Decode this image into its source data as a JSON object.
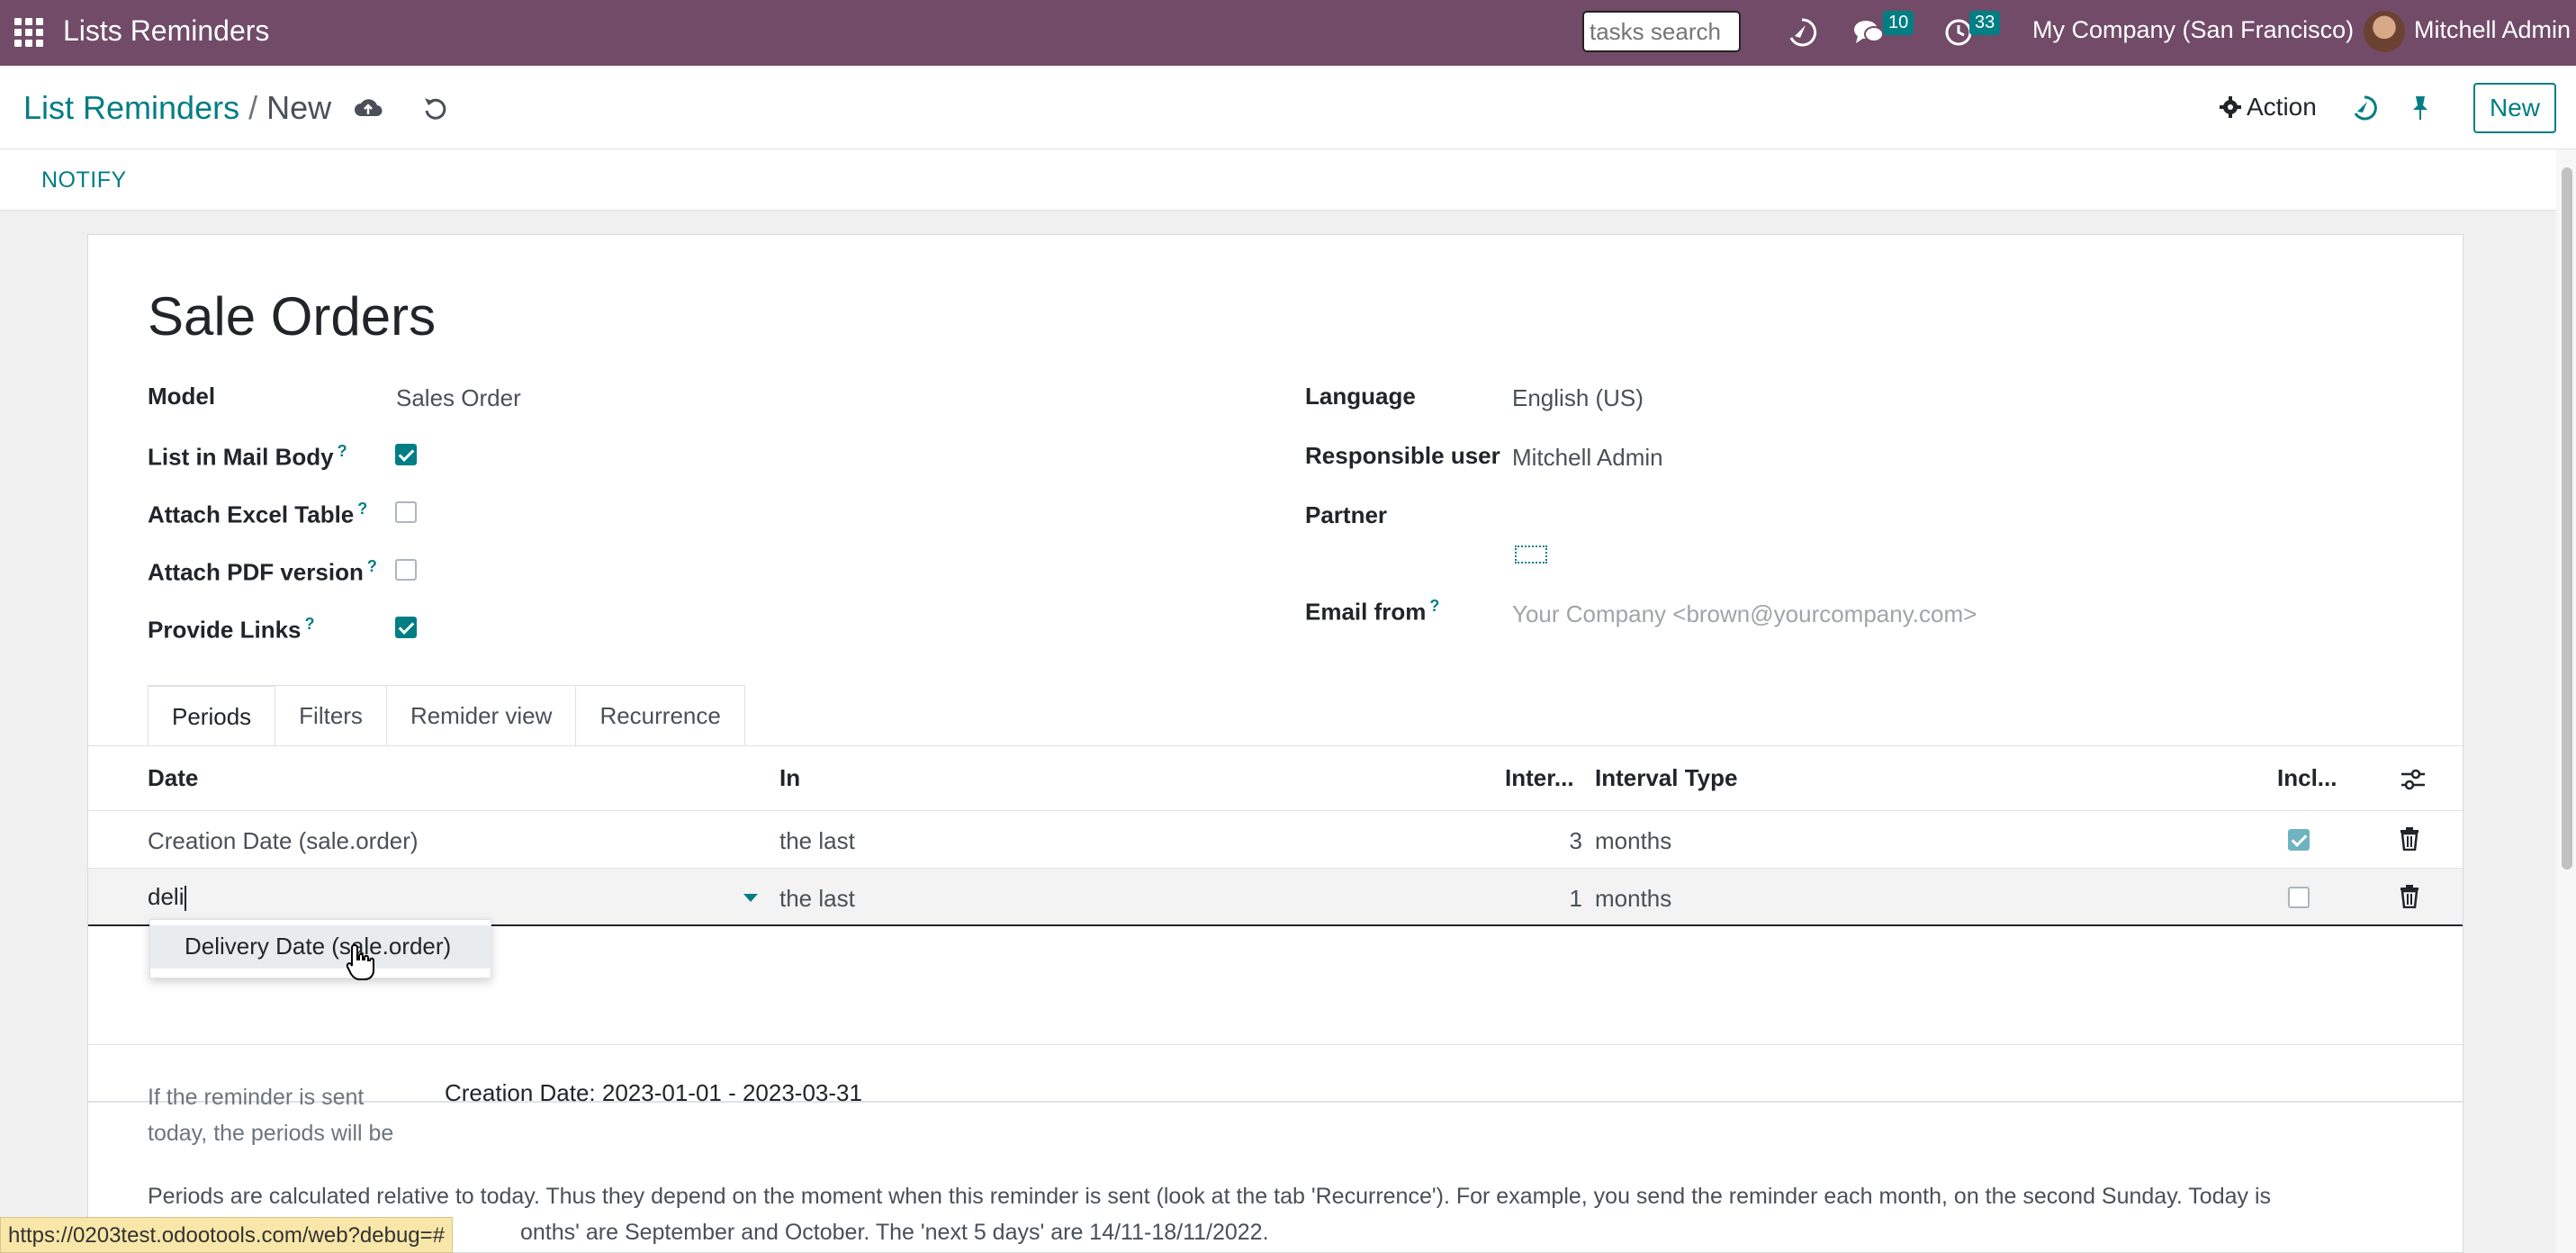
{
  "navbar": {
    "app_title": "Lists Reminders",
    "search_placeholder": "tasks search",
    "messages_count": "10",
    "activities_count": "33",
    "company": "My Company (San Francisco)",
    "user": "Mitchell Admin"
  },
  "control": {
    "breadcrumb_parent": "List Reminders",
    "breadcrumb_sep": "/",
    "breadcrumb_current": "New",
    "action_label": "Action",
    "new_label": "New"
  },
  "statusbar": {
    "notify_label": "NOTIFY"
  },
  "form": {
    "title": "Sale Orders",
    "left": [
      {
        "label": "Model",
        "value": "Sales Order"
      },
      {
        "label": "List in Mail Body",
        "tooltip": "?",
        "checked": true
      },
      {
        "label": "Attach Excel Table",
        "tooltip": "?",
        "checked": false
      },
      {
        "label": "Attach PDF version",
        "tooltip": "?",
        "checked": false
      },
      {
        "label": "Provide Links",
        "tooltip": "?",
        "checked": true
      }
    ],
    "right": [
      {
        "label": "Language",
        "value": "English (US)"
      },
      {
        "label": "Responsible user",
        "value": "Mitchell Admin"
      },
      {
        "label": "Partner",
        "value": ""
      },
      {
        "label": "Email from",
        "tooltip": "?",
        "placeholder": "Your Company <brown@yourcompany.com>"
      }
    ]
  },
  "tabs": [
    "Periods",
    "Filters",
    "Remider view",
    "Recurrence"
  ],
  "table": {
    "columns": [
      "Date",
      "In",
      "Inter...",
      "Interval Type",
      "Incl..."
    ],
    "rows": [
      {
        "date": "Creation Date (sale.order)",
        "in": "the last",
        "interval": "3",
        "type": "months",
        "incl": true
      },
      {
        "date": "deli",
        "in": "the last",
        "interval": "1",
        "type": "months",
        "incl": false
      }
    ],
    "dropdown_option": "Delivery Date (sale.order)"
  },
  "info": {
    "label": "If the reminder is sent today, the periods will be",
    "value": "Creation Date: 2023-01-01 - 2023-03-31",
    "paragraph": "Periods are calculated relative to today. Thus they depend on the moment when this reminder is sent (look at the tab 'Recurrence'). For example, you send the reminder each month, on the second Sunday. Today is",
    "paragraph2": "onths' are September and October. The 'next 5 days' are 14/11-18/11/2022."
  },
  "status_url": "https://0203test.odootools.com/web?debug=#",
  "colors": {
    "navbar": "#714b67",
    "accent": "#017e84"
  }
}
